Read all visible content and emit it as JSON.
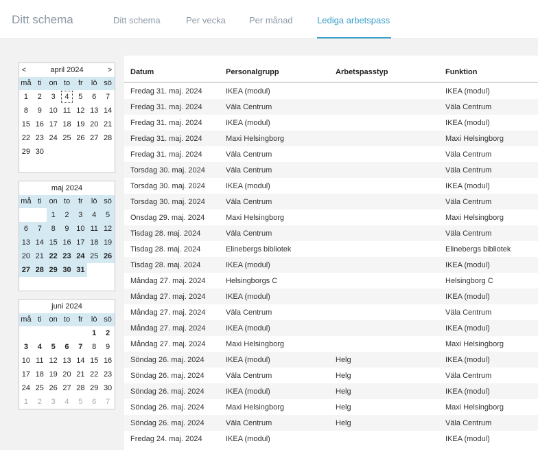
{
  "header": {
    "brand": "Ditt schema",
    "tabs": [
      {
        "label": "Ditt schema"
      },
      {
        "label": "Per vecka"
      },
      {
        "label": "Per månad"
      },
      {
        "label": "Lediga arbetspass"
      }
    ]
  },
  "calendars": [
    {
      "title": "april 2024",
      "prev": "<",
      "next": ">",
      "dow": [
        "må",
        "ti",
        "on",
        "to",
        "fr",
        "lö",
        "sö"
      ],
      "days": [
        "1",
        "2",
        "3",
        "4",
        "5",
        "6",
        "7",
        "8",
        "9",
        "10",
        "11",
        "12",
        "13",
        "14",
        "15",
        "16",
        "17",
        "18",
        "19",
        "20",
        "21",
        "22",
        "23",
        "24",
        "25",
        "26",
        "27",
        "28",
        "29",
        "30"
      ]
    },
    {
      "title": "maj 2024",
      "dow": [
        "må",
        "ti",
        "on",
        "to",
        "fr",
        "lö",
        "sö"
      ],
      "days": [
        "1",
        "2",
        "3",
        "4",
        "5",
        "6",
        "7",
        "8",
        "9",
        "10",
        "11",
        "12",
        "13",
        "14",
        "15",
        "16",
        "17",
        "18",
        "19",
        "20",
        "21",
        "22",
        "23",
        "24",
        "25",
        "26",
        "27",
        "28",
        "29",
        "30",
        "31"
      ]
    },
    {
      "title": "juni 2024",
      "dow": [
        "må",
        "ti",
        "on",
        "to",
        "fr",
        "lö",
        "sö"
      ],
      "days": [
        "1",
        "2",
        "3",
        "4",
        "5",
        "6",
        "7",
        "8",
        "9",
        "10",
        "11",
        "12",
        "13",
        "14",
        "15",
        "16",
        "17",
        "18",
        "19",
        "20",
        "21",
        "22",
        "23",
        "24",
        "25",
        "26",
        "27",
        "28",
        "29",
        "30"
      ],
      "next_days": [
        "1",
        "2",
        "3",
        "4",
        "5",
        "6",
        "7"
      ]
    }
  ],
  "table": {
    "headers": {
      "date": "Datum",
      "group": "Personalgrupp",
      "type": "Arbetspasstyp",
      "func": "Funktion"
    },
    "rows": [
      {
        "date": "Fredag 31. maj. 2024",
        "group": "IKEA (modul)",
        "type": "",
        "func": "IKEA (modul)"
      },
      {
        "date": "Fredag 31. maj. 2024",
        "group": "Väla Centrum",
        "type": "",
        "func": "Väla Centrum"
      },
      {
        "date": "Fredag 31. maj. 2024",
        "group": "IKEA (modul)",
        "type": "",
        "func": "IKEA (modul)"
      },
      {
        "date": "Fredag 31. maj. 2024",
        "group": "Maxi Helsingborg",
        "type": "",
        "func": "Maxi Helsingborg"
      },
      {
        "date": "Fredag 31. maj. 2024",
        "group": "Väla Centrum",
        "type": "",
        "func": "Väla Centrum"
      },
      {
        "date": "Torsdag 30. maj. 2024",
        "group": "Väla Centrum",
        "type": "",
        "func": "Väla Centrum"
      },
      {
        "date": "Torsdag 30. maj. 2024",
        "group": "IKEA (modul)",
        "type": "",
        "func": "IKEA (modul)"
      },
      {
        "date": "Torsdag 30. maj. 2024",
        "group": "Väla Centrum",
        "type": "",
        "func": "Väla Centrum"
      },
      {
        "date": "Onsdag 29. maj. 2024",
        "group": "Maxi Helsingborg",
        "type": "",
        "func": "Maxi Helsingborg"
      },
      {
        "date": "Tisdag 28. maj. 2024",
        "group": "Väla Centrum",
        "type": "",
        "func": "Väla Centrum"
      },
      {
        "date": "Tisdag 28. maj. 2024",
        "group": "Elinebergs bibliotek",
        "type": "",
        "func": "Elinebergs bibliotek"
      },
      {
        "date": "Tisdag 28. maj. 2024",
        "group": "IKEA (modul)",
        "type": "",
        "func": "IKEA (modul)"
      },
      {
        "date": "Måndag 27. maj. 2024",
        "group": "Helsingborgs C",
        "type": "",
        "func": "Helsingborg C"
      },
      {
        "date": "Måndag 27. maj. 2024",
        "group": "IKEA (modul)",
        "type": "",
        "func": "IKEA (modul)"
      },
      {
        "date": "Måndag 27. maj. 2024",
        "group": "Väla Centrum",
        "type": "",
        "func": "Väla Centrum"
      },
      {
        "date": "Måndag 27. maj. 2024",
        "group": "IKEA (modul)",
        "type": "",
        "func": "IKEA (modul)"
      },
      {
        "date": "Måndag 27. maj. 2024",
        "group": "Maxi Helsingborg",
        "type": "",
        "func": "Maxi Helsingborg"
      },
      {
        "date": "Söndag 26. maj. 2024",
        "group": "IKEA (modul)",
        "type": "Helg",
        "func": "IKEA (modul)"
      },
      {
        "date": "Söndag 26. maj. 2024",
        "group": "Väla Centrum",
        "type": "Helg",
        "func": "Väla Centrum"
      },
      {
        "date": "Söndag 26. maj. 2024",
        "group": "IKEA (modul)",
        "type": "Helg",
        "func": "IKEA (modul)"
      },
      {
        "date": "Söndag 26. maj. 2024",
        "group": "Maxi Helsingborg",
        "type": "Helg",
        "func": "Maxi Helsingborg"
      },
      {
        "date": "Söndag 26. maj. 2024",
        "group": "Väla Centrum",
        "type": "Helg",
        "func": "Väla Centrum"
      },
      {
        "date": "Fredag 24. maj. 2024",
        "group": "IKEA (modul)",
        "type": "",
        "func": "IKEA (modul)"
      }
    ]
  }
}
